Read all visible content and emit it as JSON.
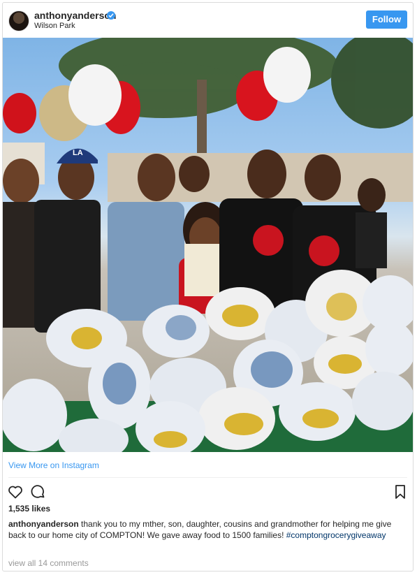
{
  "post": {
    "username": "anthonyanderson",
    "location": "Wilson Park",
    "follow_label": "Follow",
    "view_more_label": "View More on Instagram",
    "likes": "1,535 likes",
    "caption_user": "anthonyanderson",
    "caption_text": "thank you to my mther, son, daughter, cousins and grandmother for helping me give back to our home city of COMPTON! We gave away food to 1500 families!",
    "hashtag": "#comptongrocerygiveaway",
    "comments_link": "view all 14 comments"
  },
  "photo": {
    "text": {
      "cap_logo": "LA"
    }
  },
  "icons": {
    "verified": "verified-badge-icon",
    "heart": "heart-icon",
    "comment": "comment-icon",
    "bookmark": "bookmark-icon"
  },
  "colors": {
    "accent": "#3897f0",
    "text": "#262626",
    "muted": "#999999",
    "hashtag": "#003569"
  }
}
